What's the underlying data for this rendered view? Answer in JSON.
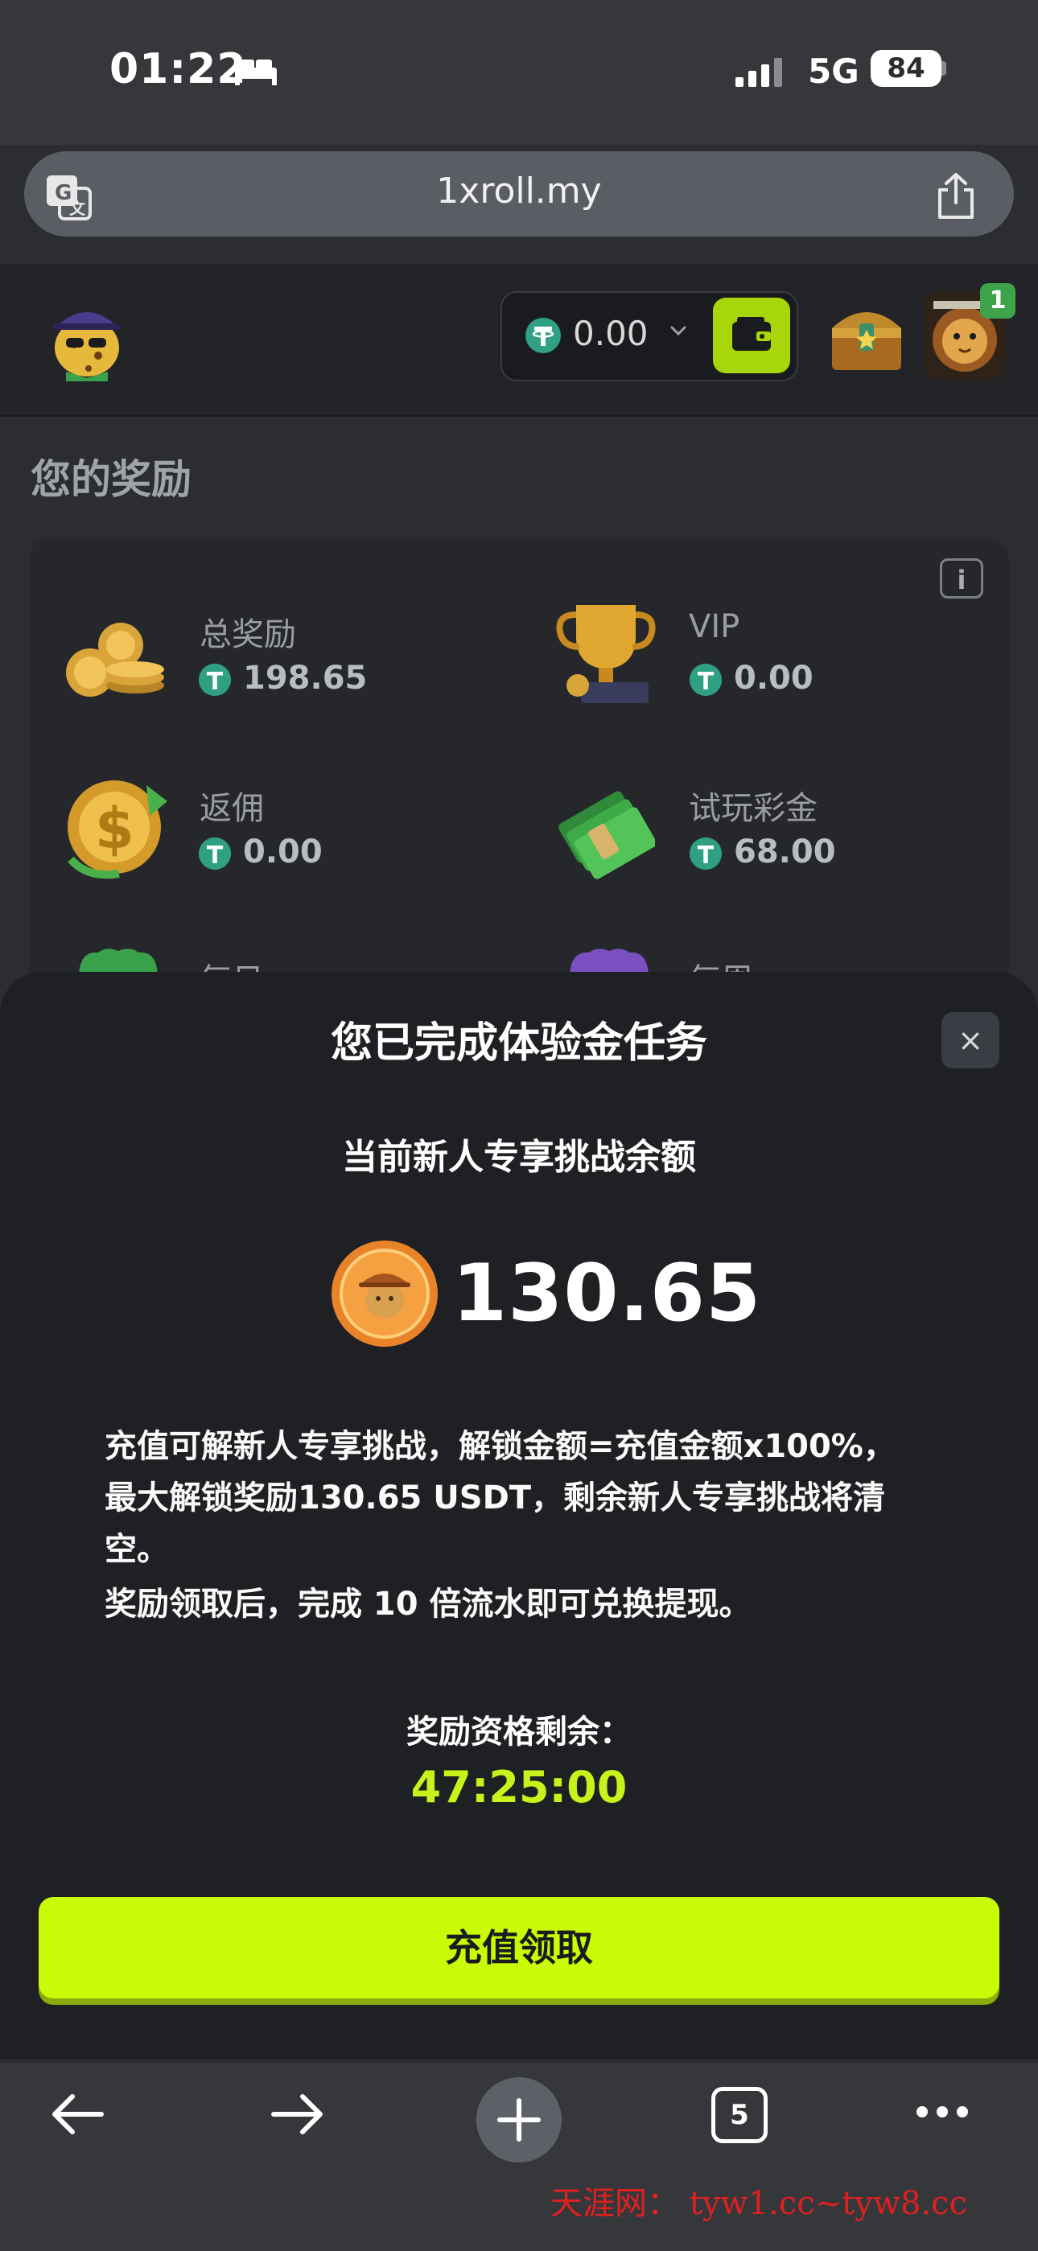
{
  "status_bar": {
    "time": "01:22",
    "network": "5G",
    "battery": "84"
  },
  "browser": {
    "url": "1xroll.my"
  },
  "header": {
    "balance": "0.00",
    "notification_count": "1"
  },
  "page": {
    "title": "您的奖励"
  },
  "rewards": [
    {
      "label": "总奖励",
      "value": "198.65",
      "icon": "coins-stack-icon"
    },
    {
      "label": "VIP",
      "value": "0.00",
      "icon": "trophy-icon"
    },
    {
      "label": "返佣",
      "value": "0.00",
      "icon": "dollar-coin-icon"
    },
    {
      "label": "试玩彩金",
      "value": "68.00",
      "icon": "cash-stack-icon"
    },
    {
      "label": "每日",
      "value": "",
      "icon": "green-gift-icon"
    },
    {
      "label": "每周",
      "value": "",
      "icon": "purple-gift-icon"
    }
  ],
  "modal": {
    "title": "您已完成体验金任务",
    "subtitle": "当前新人专享挑战余额",
    "amount": "130.65",
    "desc_1": "充值可解新人专享挑战，解锁金额=充值金额x100%，",
    "desc_2": "最大解锁奖励130.65 USDT，剩余新人专享挑战将清",
    "desc_3": "空。",
    "desc_4": "奖励领取后，完成 10 倍流水即可兑换提现。",
    "timer_label": "奖励资格剩余：",
    "timer": "47:25:00",
    "cta_label": "充值领取",
    "close_label": "×"
  },
  "toolbar": {
    "tabs_count": "5"
  },
  "watermark": "天涯网： tyw1.cc~tyw8.cc",
  "colors": {
    "accent": "#c8fb05",
    "timer": "#c6f31c",
    "tether": "#2fa084",
    "wallet": "#a7d60a"
  }
}
